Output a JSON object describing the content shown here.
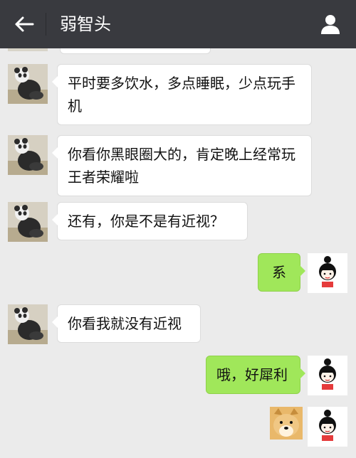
{
  "header": {
    "title": "弱智头",
    "back_icon": "back-arrow-icon",
    "contact_icon": "person-icon"
  },
  "messages": [
    {
      "side": "left",
      "text": "平时要多饮水，多点睡眠，少点玩手机"
    },
    {
      "side": "left",
      "text": "你看你黑眼圈大的，肯定晚上经常玩王者荣耀啦"
    },
    {
      "side": "left",
      "text": "还有，你是不是有近视？"
    },
    {
      "side": "right",
      "text": "系"
    },
    {
      "side": "left",
      "text": "你看我就没有近视"
    },
    {
      "side": "right",
      "text": "哦，好犀利"
    },
    {
      "side": "right",
      "text": "",
      "sticker": "doge-sticker"
    }
  ],
  "colors": {
    "header_bg": "#393a3f",
    "chat_bg": "#ebebeb",
    "outgoing_bubble": "#a0e75a",
    "incoming_bubble": "#ffffff"
  }
}
